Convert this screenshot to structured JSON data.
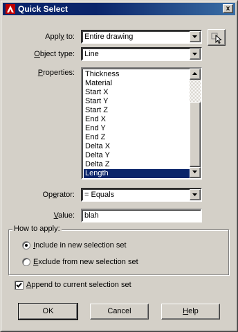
{
  "window": {
    "title": "Quick Select",
    "close_glyph": "x"
  },
  "apply_to": {
    "label_prefix": "Appl",
    "label_key": "y",
    "label_suffix": " to:",
    "value": "Entire drawing"
  },
  "object_type": {
    "label_key": "O",
    "label_suffix": "bject type:",
    "value": "Line"
  },
  "properties": {
    "label_key": "P",
    "label_suffix": "roperties:",
    "items": [
      "Thickness",
      "Material",
      "Start X",
      "Start Y",
      "Start Z",
      "End X",
      "End Y",
      "End Z",
      "Delta X",
      "Delta Y",
      "Delta Z",
      "Length"
    ],
    "selected": "Length"
  },
  "operator": {
    "label_prefix": "Op",
    "label_key": "e",
    "label_suffix": "rator:",
    "value": "= Equals"
  },
  "value_field": {
    "label_key": "V",
    "label_suffix": "alue:",
    "value": "blah"
  },
  "how_to_apply": {
    "title": "How to apply:",
    "include_key": "I",
    "include_suffix": "nclude in new selection set",
    "exclude_key": "E",
    "exclude_suffix": "xclude from new selection set",
    "selected": "include"
  },
  "append": {
    "label_key": "A",
    "label_suffix": "ppend to current selection set",
    "checked": true
  },
  "buttons": {
    "ok": "OK",
    "cancel": "Cancel",
    "help_key": "H",
    "help_suffix": "elp"
  },
  "icons": {
    "title_icon": "autocad-app-icon",
    "pick_icon": "select-objects-icon"
  }
}
